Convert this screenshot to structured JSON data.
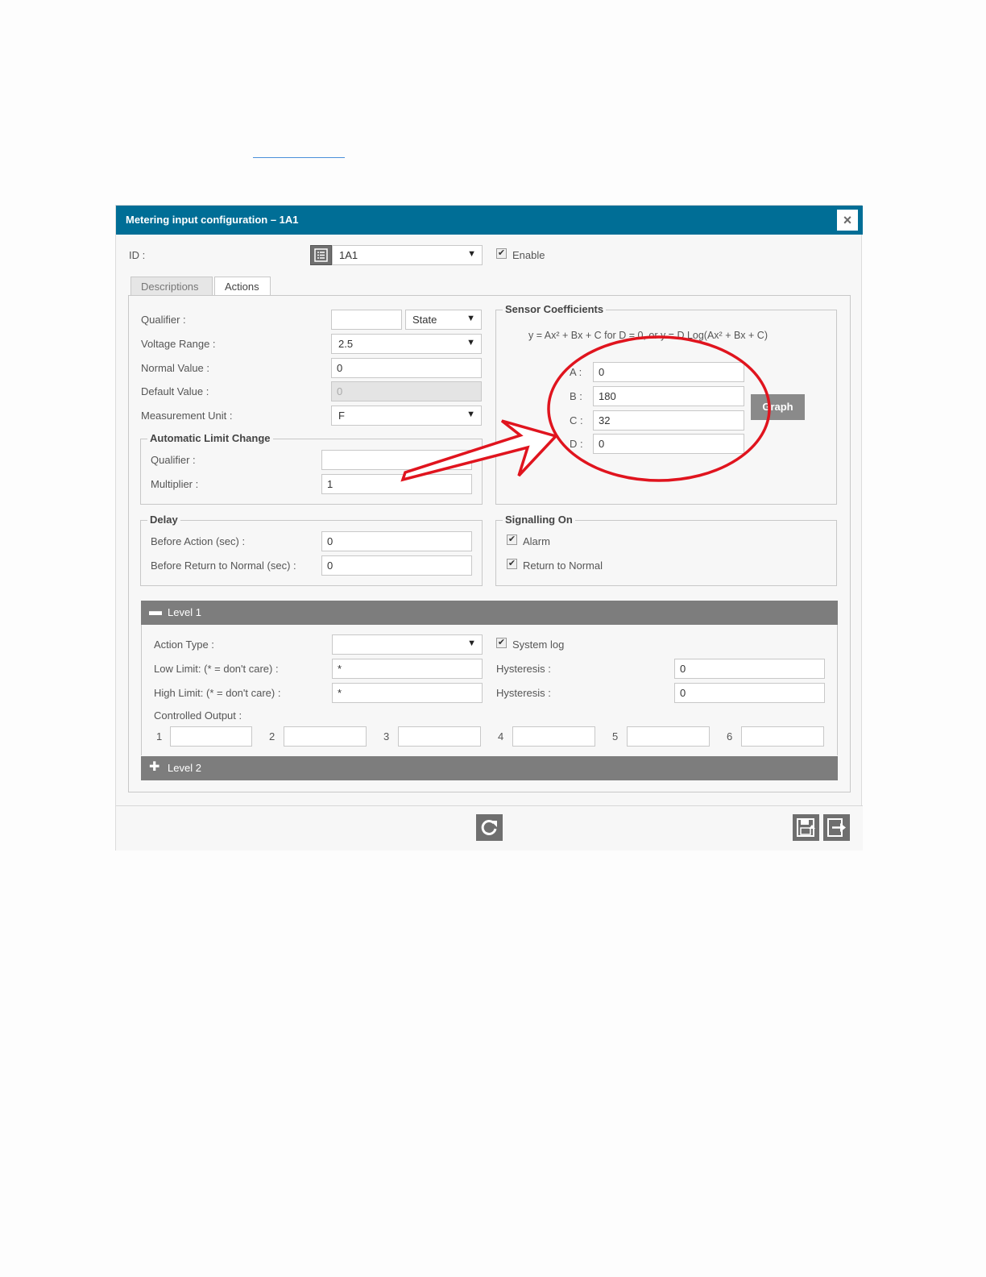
{
  "dialog": {
    "title": "Metering input configuration – 1A1",
    "close_icon": "×"
  },
  "header": {
    "id_label": "ID :",
    "id_value": "1A1",
    "enable_label": "Enable",
    "enable_checked": true
  },
  "tabs": [
    {
      "label": "Descriptions",
      "active": false
    },
    {
      "label": "Actions",
      "active": true
    }
  ],
  "left": {
    "qualifier_label": "Qualifier :",
    "qualifier_value": "",
    "qualifier_select": "State",
    "voltage_label": "Voltage Range :",
    "voltage_value": "2.5",
    "normal_label": "Normal Value :",
    "normal_value": "0",
    "default_label": "Default Value :",
    "default_value": "0",
    "unit_label": "Measurement Unit :",
    "unit_value": "F"
  },
  "auto_limit": {
    "legend": "Automatic Limit Change",
    "qualifier_label": "Qualifier :",
    "qualifier_value": "",
    "multiplier_label": "Multiplier :",
    "multiplier_value": "1"
  },
  "sensor": {
    "legend": "Sensor Coefficients",
    "formula": "y = Ax² + Bx + C for D = 0, or y = D Log(Ax² + Bx + C)",
    "a_label": "A :",
    "a_value": "0",
    "b_label": "B :",
    "b_value": "180",
    "c_label": "C :",
    "c_value": "32",
    "d_label": "D :",
    "d_value": "0",
    "graph_label": "Graph"
  },
  "delay": {
    "legend": "Delay",
    "before_action_label": "Before Action (sec) :",
    "before_action_value": "0",
    "before_return_label": "Before Return to Normal (sec) :",
    "before_return_value": "0"
  },
  "signalling": {
    "legend": "Signalling On",
    "alarm_label": "Alarm",
    "return_label": "Return to Normal"
  },
  "level1": {
    "title": "Level 1",
    "action_type_label": "Action Type :",
    "action_type_value": "",
    "system_log_label": "System log",
    "low_limit_label": "Low Limit: (* = don't care) :",
    "low_limit_value": "*",
    "high_limit_label": "High Limit: (* = don't care) :",
    "high_limit_value": "*",
    "hysteresis_label_1": "Hysteresis :",
    "hysteresis_value_1": "0",
    "hysteresis_label_2": "Hysteresis :",
    "hysteresis_value_2": "0",
    "controlled_output_label": "Controlled Output :",
    "outputs": [
      {
        "num": "1",
        "value": ""
      },
      {
        "num": "2",
        "value": ""
      },
      {
        "num": "3",
        "value": ""
      },
      {
        "num": "4",
        "value": ""
      },
      {
        "num": "5",
        "value": ""
      },
      {
        "num": "6",
        "value": ""
      }
    ]
  },
  "level2": {
    "title": "Level 2"
  },
  "annotation_color": "#e0141e",
  "accent_color": "#006e96"
}
